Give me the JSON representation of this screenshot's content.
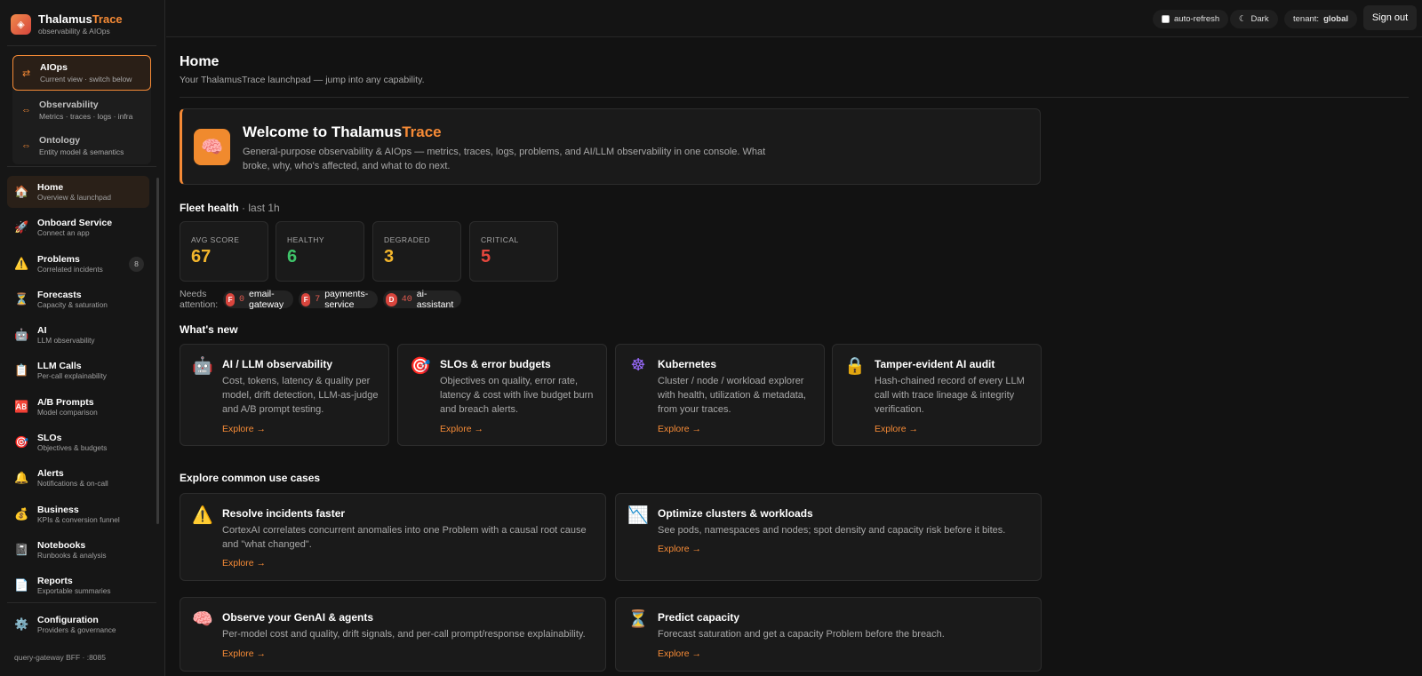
{
  "brand": {
    "name_main": "Thalamus",
    "name_accent": "Trace",
    "tagline": "observability & AIOps",
    "logo_icon": "◈"
  },
  "switcher": [
    {
      "title": "AIOps",
      "sub": "Current view · switch below",
      "icon": "⇄"
    },
    {
      "title": "Observability",
      "sub": "Metrics · traces · logs · infra",
      "icon": "⇔"
    },
    {
      "title": "Ontology",
      "sub": "Entity model & semantics",
      "icon": "⇔"
    }
  ],
  "nav": [
    {
      "title": "Home",
      "sub": "Overview & launchpad",
      "icon": "🏠"
    },
    {
      "title": "Onboard Service",
      "sub": "Connect an app",
      "icon": "🚀"
    },
    {
      "title": "Problems",
      "sub": "Correlated incidents",
      "icon": "⚠️",
      "badge": "8"
    },
    {
      "title": "Forecasts",
      "sub": "Capacity & saturation",
      "icon": "⏳"
    },
    {
      "title": "AI",
      "sub": "LLM observability",
      "icon": "🤖"
    },
    {
      "title": "LLM Calls",
      "sub": "Per-call explainability",
      "icon": "📋"
    },
    {
      "title": "A/B Prompts",
      "sub": "Model comparison",
      "icon": "🆎"
    },
    {
      "title": "SLOs",
      "sub": "Objectives & budgets",
      "icon": "🎯"
    },
    {
      "title": "Alerts",
      "sub": "Notifications & on-call",
      "icon": "🔔"
    },
    {
      "title": "Business",
      "sub": "KPIs & conversion funnel",
      "icon": "💰"
    },
    {
      "title": "Notebooks",
      "sub": "Runbooks & analysis",
      "icon": "📓"
    },
    {
      "title": "Reports",
      "sub": "Exportable summaries",
      "icon": "📄"
    }
  ],
  "config": {
    "title": "Configuration",
    "sub": "Providers & governance",
    "icon": "⚙️"
  },
  "footer": "query-gateway BFF · :8085",
  "topbar": {
    "auto_refresh": "auto-refresh",
    "theme": "Dark",
    "theme_icon": "☾",
    "tenant_label": "tenant:",
    "tenant_value": "global",
    "sign_out": "Sign out"
  },
  "page": {
    "title": "Home",
    "subtitle": "Your ThalamusTrace launchpad — jump into any capability."
  },
  "welcome": {
    "title_main": "Welcome to Thalamus",
    "title_accent": "Trace",
    "icon": "🧠",
    "desc": "General-purpose observability & AIOps — metrics, traces, logs, problems, and AI/LLM observability in one console. What broke, why, who's affected, and what to do next."
  },
  "fleet": {
    "title": "Fleet health",
    "window": "· last 1h",
    "stats": [
      {
        "label": "AVG SCORE",
        "value": "67",
        "color": "#f2b52c"
      },
      {
        "label": "HEALTHY",
        "value": "6",
        "color": "#3fc46a"
      },
      {
        "label": "DEGRADED",
        "value": "3",
        "color": "#f2b52c"
      },
      {
        "label": "CRITICAL",
        "value": "5",
        "color": "#e5473d"
      }
    ],
    "attention_label": "Needs attention:",
    "attention": [
      {
        "grade": "F",
        "count": "0",
        "name": "email-gateway"
      },
      {
        "grade": "F",
        "count": "7",
        "name": "payments-service"
      },
      {
        "grade": "D",
        "count": "40",
        "name": "ai-assistant"
      }
    ]
  },
  "whats_new": {
    "title": "What's new",
    "cards": [
      {
        "icon": "🤖",
        "title": "AI / LLM observability",
        "desc": "Cost, tokens, latency & quality per model, drift detection, LLM-as-judge and A/B prompt testing.",
        "link": "Explore →"
      },
      {
        "icon": "🎯",
        "title": "SLOs & error budgets",
        "desc": "Objectives on quality, error rate, latency & cost with live budget burn and breach alerts.",
        "link": "Explore →"
      },
      {
        "icon": "☸",
        "title": "Kubernetes",
        "desc": "Cluster / node / workload explorer with health, utilization & metadata, from your traces.",
        "link": "Explore →"
      },
      {
        "icon": "🔒",
        "title": "Tamper-evident AI audit",
        "desc": "Hash-chained record of every LLM call with trace lineage & integrity verification.",
        "link": "Explore →"
      }
    ]
  },
  "use_cases": {
    "title": "Explore common use cases",
    "cards": [
      {
        "icon": "⚠️",
        "title": "Resolve incidents faster",
        "desc": "CortexAI correlates concurrent anomalies into one Problem with a causal root cause and \"what changed\".",
        "link": "Explore →"
      },
      {
        "icon": "📉",
        "title": "Optimize clusters & workloads",
        "desc": "See pods, namespaces and nodes; spot density and capacity risk before it bites.",
        "link": "Explore →"
      },
      {
        "icon": "🧠",
        "title": "Observe your GenAI & agents",
        "desc": "Per-model cost and quality, drift signals, and per-call prompt/response explainability.",
        "link": "Explore →"
      },
      {
        "icon": "⏳",
        "title": "Predict capacity",
        "desc": "Forecast saturation and get a capacity Problem before the breach.",
        "link": "Explore →"
      }
    ]
  }
}
